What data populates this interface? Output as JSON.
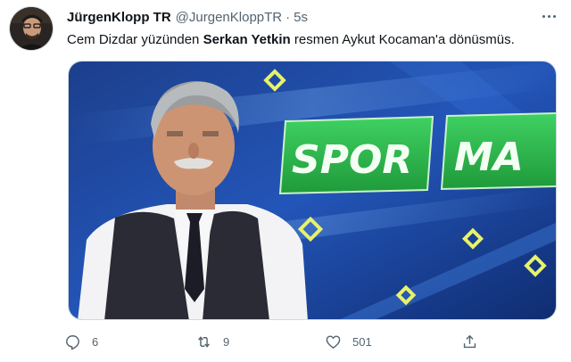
{
  "tweet": {
    "author": {
      "display_name": "JürgenKlopp TR",
      "handle": "@JurgenKloppTR",
      "separator": "·",
      "time": "5s"
    },
    "text": {
      "part1": "Cem Dizdar yüzünden ",
      "bold": "Serkan Yetkin",
      "part2": " resmen Aykut Kocaman'a dönüsmüs."
    },
    "media": {
      "banner_word1": "SPOR",
      "banner_word2": "MA"
    },
    "actions": {
      "reply_count": "6",
      "retweet_count": "9",
      "like_count": "501"
    },
    "icons": {
      "reply": "reply-icon",
      "retweet": "retweet-icon",
      "like": "heart-icon",
      "share": "share-icon",
      "more": "more-icon"
    },
    "colors": {
      "text_primary": "#0f1419",
      "text_secondary": "#536471",
      "banner_green": "#2bb34a",
      "studio_blue": "#1d4ea6"
    }
  }
}
